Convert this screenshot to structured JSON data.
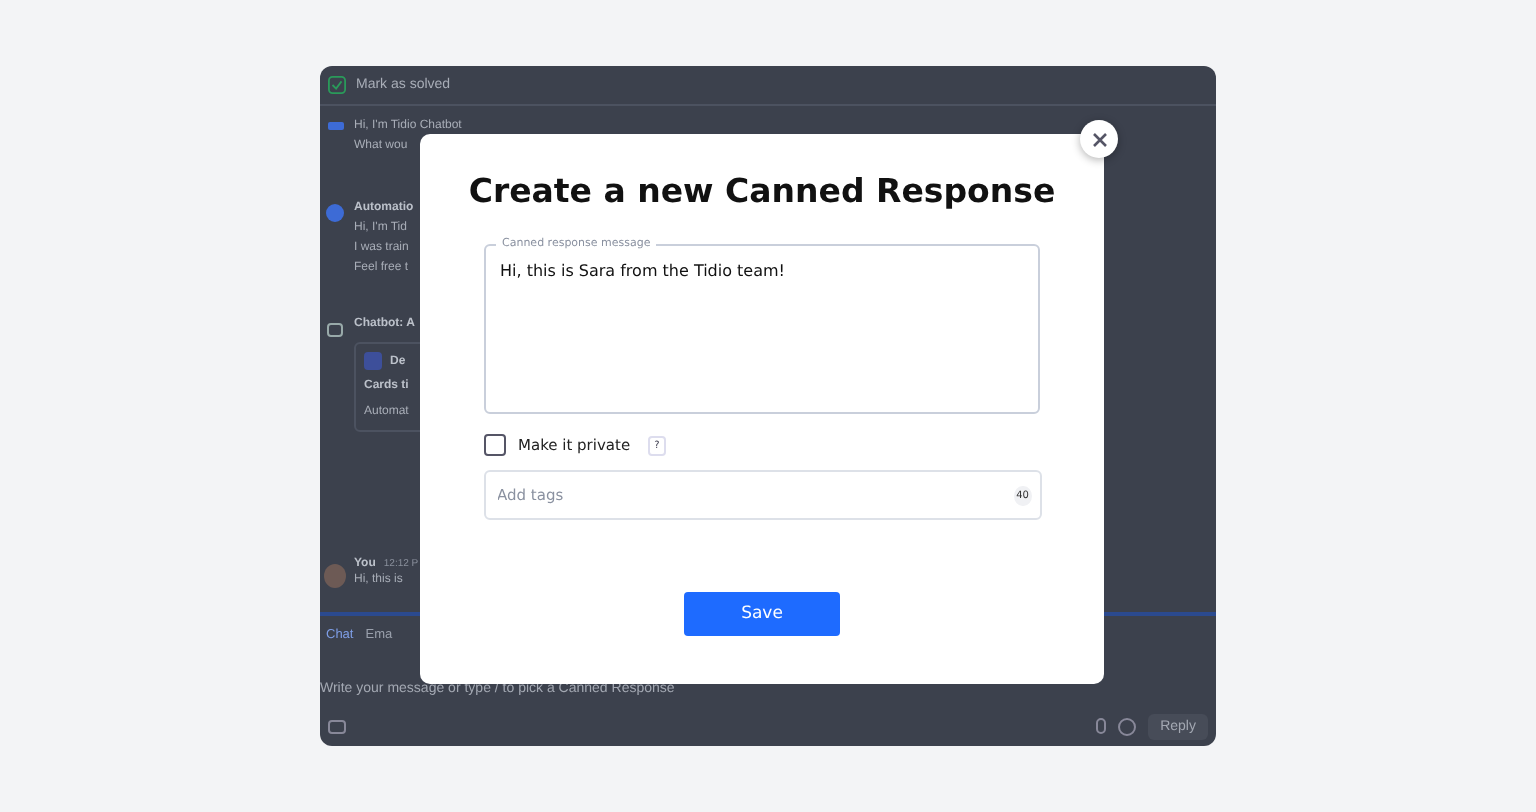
{
  "background_app": {
    "top_bar": {
      "action": "Mark as solved"
    },
    "messages": [
      {
        "kind": "bot",
        "lines": [
          "Hi, I'm Tidio Chatbot",
          "What wou"
        ]
      },
      {
        "kind": "automation",
        "lines": [
          "Automatio",
          "Hi, I'm Tid",
          "I was train",
          "Feel free t"
        ]
      },
      {
        "kind": "card",
        "lines": [
          "Chatbot: A"
        ],
        "card_title": "De",
        "card_lines": [
          "Cards ti",
          "Automat"
        ]
      },
      {
        "kind": "you",
        "author": "You",
        "time": "12:12 P",
        "lines": [
          "Hi, this is"
        ]
      }
    ],
    "channel_tabs": [
      {
        "label": "Chat",
        "selected": true
      },
      {
        "label": "Ema",
        "selected": false
      }
    ],
    "composer": {
      "placeholder": "Write your message or type / to pick a Canned Response"
    },
    "reply_button": "Reply"
  },
  "modal": {
    "title": "Create a new Canned Response",
    "message_field": {
      "label": "Canned response message",
      "value": "Hi, this is Sara from the Tidio team!"
    },
    "private_checkbox": {
      "label": "Make it private",
      "checked": false,
      "help": "?"
    },
    "tags_field": {
      "placeholder": "Add tags",
      "counter": "40"
    },
    "save_button": "Save"
  }
}
